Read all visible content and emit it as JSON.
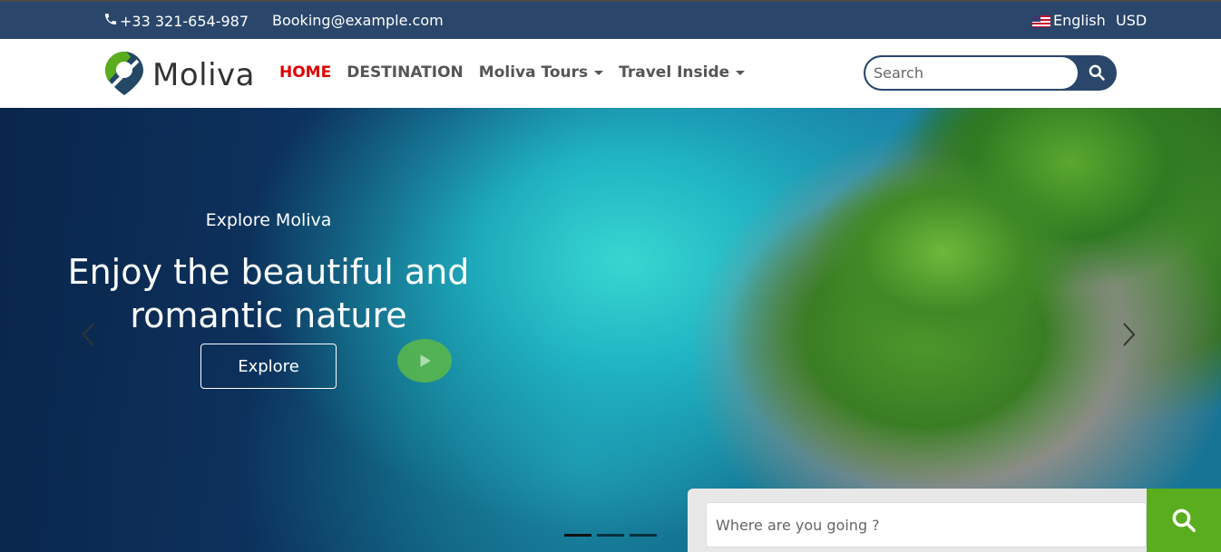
{
  "topbar": {
    "phone": "+33 321-654-987",
    "email": "Booking@example.com",
    "language": "English",
    "currency": "USD"
  },
  "brand": {
    "name": "Moliva"
  },
  "nav": {
    "items": [
      {
        "label": "HOME",
        "active": true
      },
      {
        "label": "DESTINATION",
        "active": false
      },
      {
        "label": "Moliva Tours",
        "dropdown": true
      },
      {
        "label": "Travel Inside",
        "dropdown": true
      }
    ]
  },
  "search": {
    "placeholder": "Search"
  },
  "hero": {
    "kicker": "Explore Moliva",
    "title_line1": "Enjoy the beautiful and",
    "title_line2": "romantic nature",
    "button": "Explore"
  },
  "destination_search": {
    "placeholder": "Where are you going ?"
  },
  "colors": {
    "topbar": "#2a476b",
    "active_nav": "#e00000",
    "accent_green": "#5aad1e"
  }
}
